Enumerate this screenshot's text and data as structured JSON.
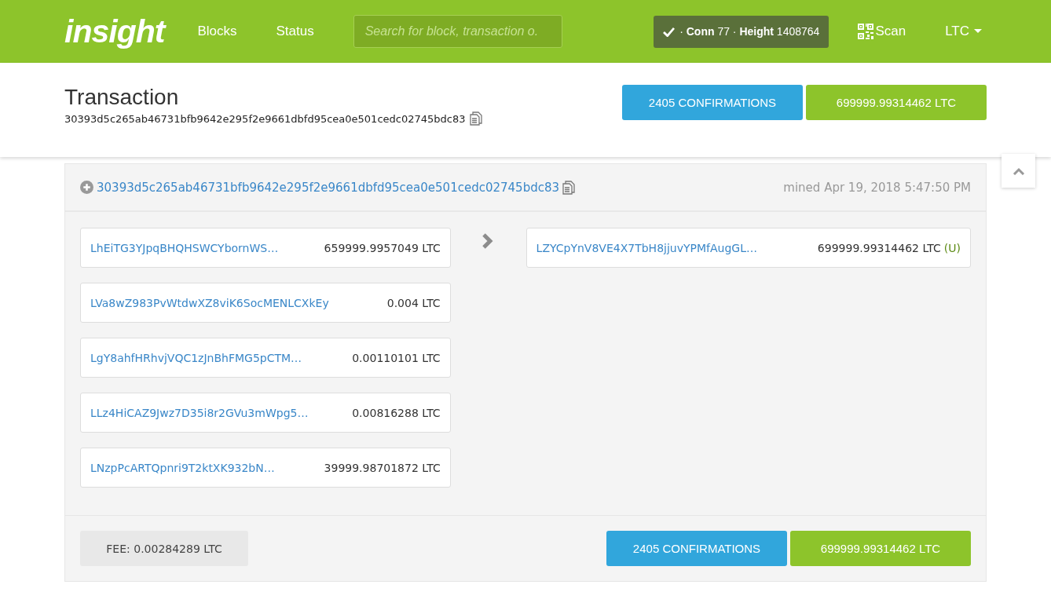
{
  "navbar": {
    "logo": "insight",
    "links": [
      "Blocks",
      "Status"
    ],
    "search": {
      "placeholder": "Search for block, transaction o."
    },
    "status": "· **Conn** 77 · **Height** 1408764",
    "scan": "Scan",
    "currency": "LTC"
  },
  "header": {
    "title": "Transaction",
    "txid": "30393d5c265ab46731bfb9642e295f2e9661dbfd95cea0e501cedc02745bdc83",
    "confirmations": "2405 CONFIRMATIONS",
    "amount": "699999.99314462 LTC"
  },
  "tx": {
    "txid": "30393d5c265ab46731bfb9642e295f2e9661dbfd95cea0e501cedc02745bdc83",
    "mined": "mined Apr 19, 2018 5:47:50 PM",
    "inputs": [
      {
        "address": "LhEiTG3YJpqBHQHSWCYbornWS…",
        "amount": "659999.9957049 LTC"
      },
      {
        "address": "LVa8wZ983PvWtdwXZ8viK6SocMENLCXkEy",
        "amount": "0.004 LTC"
      },
      {
        "address": "LgY8ahfHRhvjVQC1zJnBhFMG5pCTM…",
        "amount": "0.00110101 LTC"
      },
      {
        "address": "LLz4HiCAZ9Jwz7D35i8r2GVu3mWpg5…",
        "amount": "0.00816288 LTC"
      },
      {
        "address": "LNzpPcARTQpnri9T2ktXK932bN…",
        "amount": "39999.98701872 LTC"
      }
    ],
    "outputs": [
      {
        "address": "LZYCpYnV8VE4X7TbH8jjuvYPMfAugGL…",
        "amount": "699999.99314462 LTC",
        "flag": "(U)"
      }
    ],
    "fee": "FEE: 0.00284289 LTC",
    "confirmations": "2405 CONFIRMATIONS",
    "amount": "699999.99314462 LTC"
  }
}
